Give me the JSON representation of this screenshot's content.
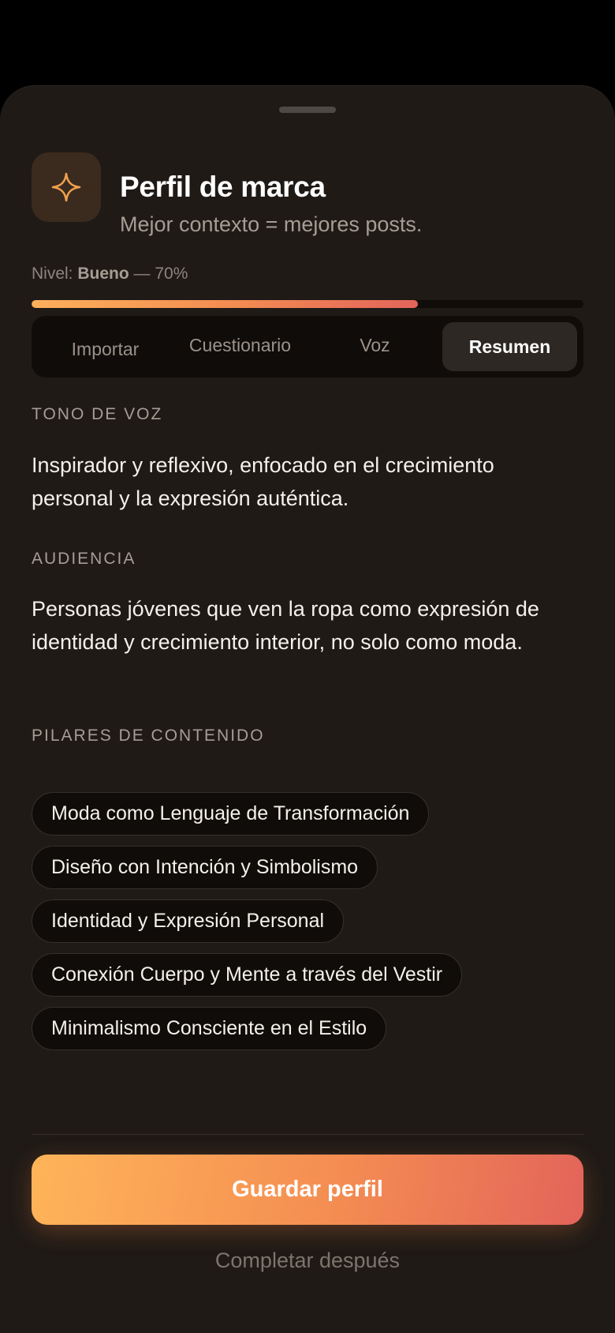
{
  "header": {
    "title": "Perfil de marca",
    "subtitle": "Mejor contexto = mejores posts.",
    "icon": "sparkle-icon",
    "accent_color": "#f2a14f"
  },
  "level": {
    "prefix": "Nivel: ",
    "name": "Bueno",
    "suffix": " — 70%",
    "progress_fraction": 0.7
  },
  "tabs": [
    {
      "label": "Importar",
      "active": false
    },
    {
      "label": "Cuestionario",
      "active": false
    },
    {
      "label": "Voz",
      "active": false
    },
    {
      "label": "Resumen",
      "active": true
    }
  ],
  "summary": {
    "tone": {
      "label": "TONO DE VOZ",
      "text": "Inspirador y reflexivo, enfocado en el crecimiento personal y la expresión auténtica."
    },
    "audience": {
      "label": "AUDIENCIA",
      "text": "Personas jóvenes que ven la ropa como expresión de identidad y crecimiento interior, no solo como moda."
    },
    "pillars": {
      "label": "PILARES DE CONTENIDO",
      "items": [
        "Moda como Lenguaje de Transformación",
        "Diseño con Intención y Simbolismo",
        "Identidad y Expresión Personal",
        "Conexión Cuerpo y Mente a través del Vestir",
        "Minimalismo Consciente en el Estilo"
      ]
    }
  },
  "actions": {
    "save_label": "Guardar perfil",
    "later_label": "Completar después"
  },
  "colors": {
    "gradient_start": "#ffb459",
    "gradient_end": "#e3645a",
    "background": "#1f1a16"
  }
}
